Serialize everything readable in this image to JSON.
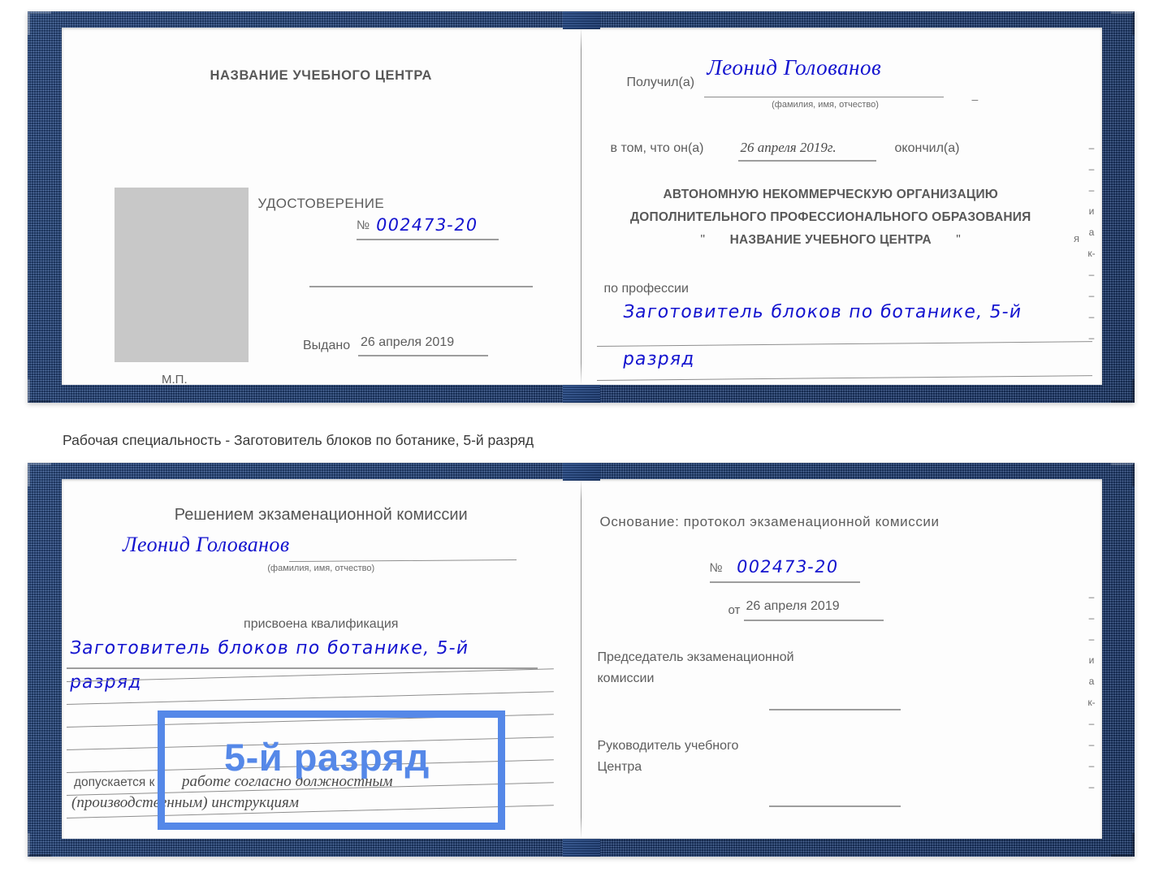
{
  "caption": "Рабочая специальность - Заготовитель блоков по ботанике, 5-й разряд",
  "doc_top": {
    "left_page": {
      "title": "НАЗВАНИЕ УЧЕБНОГО ЦЕНТРА",
      "certificate_label": "УДОСТОВЕРЕНИЕ",
      "number_symbol": "№",
      "number_value": "002473-20",
      "issued_label": "Выдано",
      "issued_date": "26 апреля 2019",
      "stamp_label": "М.П."
    },
    "right_page": {
      "received_label": "Получил(а)",
      "received_name": "Леонид Голованов",
      "fio_hint": "(фамилия, имя, отчество)",
      "in_that_label": "в том, что он(а)",
      "finish_date": "26 апреля 2019г.",
      "finished_label": "окончил(а)",
      "org_line1": "АВТОНОМНУЮ НЕКОММЕРЧЕСКУЮ ОРГАНИЗАЦИЮ",
      "org_line2": "ДОПОЛНИТЕЛЬНОГО ПРОФЕССИОНАЛЬНОГО ОБРАЗОВАНИЯ",
      "org_quote_open": "\"",
      "org_name": "НАЗВАНИЕ УЧЕБНОГО ЦЕНТРА",
      "org_quote_close": "\"",
      "profession_label": "по профессии",
      "profession_line1": "Заготовитель блоков по ботанике, 5-й",
      "profession_line2": "разряд",
      "edge_column": [
        "–",
        "–",
        "–",
        "и",
        "а",
        "к-",
        "–",
        "–",
        "–",
        "–"
      ]
    }
  },
  "doc_bottom": {
    "left_page": {
      "decision_title": "Решением экзаменационной комиссии",
      "name": "Леонид Голованов",
      "fio_hint": "(фамилия, имя, отчество)",
      "qualification_label": "присвоена квалификация",
      "qualification_line1": "Заготовитель блоков по ботанике, 5-й",
      "qualification_line2": "разряд",
      "allowed_label": "допускается к",
      "allowed_line1": "работе согласно должностным",
      "allowed_line2": "(производственным) инструкциям",
      "highlight_text": "5-й разряд"
    },
    "right_page": {
      "basis_label": "Основание: протокол экзаменационной комиссии",
      "number_symbol": "№",
      "number_value": "002473-20",
      "from_label": "от",
      "from_date": "26 апреля 2019",
      "chairman_line1": "Председатель экзаменационной",
      "chairman_line2": "комиссии",
      "head_line1": "Руководитель учебного",
      "head_line2": "Центра",
      "edge_column": [
        "–",
        "–",
        "–",
        "и",
        "а",
        "к-",
        "–",
        "–",
        "–",
        "–"
      ]
    }
  },
  "colors": {
    "cover": "#274b88",
    "ink": "#1414cf",
    "highlight": "#5588e8",
    "text": "#5d5d5d"
  }
}
